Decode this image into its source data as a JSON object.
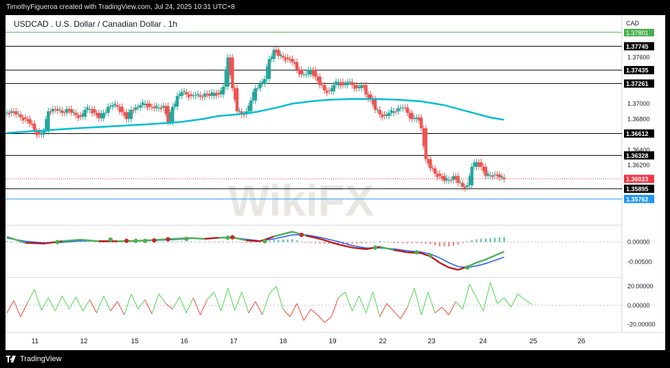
{
  "header": {
    "credit": "TimothyFigueroa created with TradingView.com, Jul 24, 2025 10:31 UTC+8"
  },
  "footer": {
    "brand": "TradingView"
  },
  "watermark": {
    "text": "WikiFX"
  },
  "chart_data": {
    "type": "candlestick",
    "title": "USDCAD . U.S. Dollar / Canadian Dollar . 1h",
    "currency": "CAD",
    "x_ticks": [
      "11",
      "12",
      "15",
      "16",
      "17",
      "18",
      "19",
      "22",
      "23",
      "24",
      "25",
      "26"
    ],
    "price_ticks": [
      1.376,
      1.37,
      1.368,
      1.364,
      1.362
    ],
    "ylim": [
      1.356,
      1.379
    ],
    "horizontal_levels": [
      {
        "label": "1.37745",
        "value": 1.37745
      },
      {
        "label": "1.37435",
        "value": 1.37435
      },
      {
        "label": "1.37261",
        "value": 1.37261
      },
      {
        "label": "1.36612",
        "value": 1.36612
      },
      {
        "label": "1.36328",
        "value": 1.36328
      },
      {
        "label": "1.35895",
        "value": 1.35895
      }
    ],
    "top_badge": {
      "label": "1.37801",
      "color": "#4caf50"
    },
    "current_price": {
      "label": "1.36023",
      "value": 1.36023,
      "color": "#f23645"
    },
    "low_line": {
      "label": "1.35762",
      "value": 1.35762,
      "color": "#2196f3"
    },
    "close_path": [
      [
        0,
        1.3688
      ],
      [
        2,
        1.369
      ],
      [
        4,
        1.3686
      ],
      [
        6,
        1.3682
      ],
      [
        8,
        1.368
      ],
      [
        10,
        1.3674
      ],
      [
        12,
        1.3664
      ],
      [
        14,
        1.366
      ],
      [
        16,
        1.3664
      ],
      [
        18,
        1.369
      ],
      [
        20,
        1.3693
      ],
      [
        22,
        1.3691
      ],
      [
        24,
        1.3688
      ],
      [
        26,
        1.3693
      ],
      [
        28,
        1.3688
      ],
      [
        30,
        1.3685
      ],
      [
        32,
        1.3683
      ],
      [
        34,
        1.3692
      ],
      [
        36,
        1.3693
      ],
      [
        38,
        1.3688
      ],
      [
        40,
        1.3681
      ],
      [
        42,
        1.3688
      ],
      [
        44,
        1.3696
      ],
      [
        46,
        1.3698
      ],
      [
        48,
        1.3696
      ],
      [
        50,
        1.3689
      ],
      [
        52,
        1.368
      ],
      [
        54,
        1.3692
      ],
      [
        56,
        1.3695
      ],
      [
        58,
        1.3698
      ],
      [
        60,
        1.37
      ],
      [
        62,
        1.3696
      ],
      [
        64,
        1.3694
      ],
      [
        66,
        1.3695
      ],
      [
        68,
        1.3697
      ],
      [
        70,
        1.3676
      ],
      [
        72,
        1.3696
      ],
      [
        74,
        1.371
      ],
      [
        76,
        1.3715
      ],
      [
        78,
        1.3712
      ],
      [
        80,
        1.371
      ],
      [
        82,
        1.3711
      ],
      [
        84,
        1.3709
      ],
      [
        86,
        1.3713
      ],
      [
        88,
        1.371
      ],
      [
        90,
        1.3714
      ],
      [
        92,
        1.3712
      ],
      [
        94,
        1.3722
      ],
      [
        96,
        1.376
      ],
      [
        98,
        1.372
      ],
      [
        100,
        1.369
      ],
      [
        102,
        1.3686
      ],
      [
        104,
        1.369
      ],
      [
        106,
        1.3704
      ],
      [
        108,
        1.372
      ],
      [
        110,
        1.3726
      ],
      [
        112,
        1.3732
      ],
      [
        114,
        1.3758
      ],
      [
        116,
        1.377
      ],
      [
        118,
        1.3762
      ],
      [
        120,
        1.376
      ],
      [
        122,
        1.3758
      ],
      [
        124,
        1.3754
      ],
      [
        126,
        1.3744
      ],
      [
        128,
        1.3738
      ],
      [
        130,
        1.3738
      ],
      [
        132,
        1.3744
      ],
      [
        134,
        1.3735
      ],
      [
        136,
        1.3724
      ],
      [
        138,
        1.3717
      ],
      [
        140,
        1.3716
      ],
      [
        142,
        1.3724
      ],
      [
        144,
        1.3728
      ],
      [
        146,
        1.3724
      ],
      [
        148,
        1.3728
      ],
      [
        150,
        1.3724
      ],
      [
        152,
        1.372
      ],
      [
        154,
        1.3724
      ],
      [
        156,
        1.3712
      ],
      [
        158,
        1.3706
      ],
      [
        160,
        1.3692
      ],
      [
        162,
        1.3686
      ],
      [
        164,
        1.3684
      ],
      [
        166,
        1.3688
      ],
      [
        168,
        1.369
      ],
      [
        170,
        1.3694
      ],
      [
        172,
        1.3695
      ],
      [
        174,
        1.3688
      ],
      [
        176,
        1.368
      ],
      [
        178,
        1.3682
      ],
      [
        180,
        1.3668
      ],
      [
        182,
        1.3628
      ],
      [
        184,
        1.3616
      ],
      [
        186,
        1.3609
      ],
      [
        188,
        1.3606
      ],
      [
        190,
        1.36
      ],
      [
        192,
        1.3601
      ],
      [
        194,
        1.3606
      ],
      [
        196,
        1.3597
      ],
      [
        198,
        1.3592
      ],
      [
        200,
        1.3594
      ],
      [
        202,
        1.3618
      ],
      [
        204,
        1.3624
      ],
      [
        206,
        1.3618
      ],
      [
        208,
        1.3606
      ],
      [
        210,
        1.3607
      ],
      [
        212,
        1.3608
      ],
      [
        214,
        1.3604
      ],
      [
        216,
        1.3602
      ]
    ],
    "ema_path": [
      [
        0,
        1.3662
      ],
      [
        30,
        1.3668
      ],
      [
        60,
        1.3673
      ],
      [
        75,
        1.3676
      ],
      [
        85,
        1.368
      ],
      [
        92,
        1.3684
      ],
      [
        100,
        1.3686
      ],
      [
        108,
        1.3689
      ],
      [
        116,
        1.3694
      ],
      [
        124,
        1.37
      ],
      [
        132,
        1.3703
      ],
      [
        140,
        1.3705
      ],
      [
        150,
        1.3706
      ],
      [
        160,
        1.3706
      ],
      [
        170,
        1.3705
      ],
      [
        180,
        1.3703
      ],
      [
        190,
        1.3698
      ],
      [
        200,
        1.369
      ],
      [
        210,
        1.3682
      ],
      [
        216,
        1.3679
      ]
    ],
    "macd": {
      "ticks": [
        "0.00000",
        "-0.00500"
      ],
      "range": [
        -0.0082,
        0.0032
      ],
      "fast": [
        [
          0,
          0.0013
        ],
        [
          8,
          -0.0002
        ],
        [
          16,
          -0.0004
        ],
        [
          24,
          0.0002
        ],
        [
          32,
          0.0006
        ],
        [
          40,
          0.0002
        ],
        [
          48,
          0.0002
        ],
        [
          56,
          0.0003
        ],
        [
          64,
          0.0005
        ],
        [
          72,
          0.0008
        ],
        [
          80,
          0.001
        ],
        [
          86,
          0.0008
        ],
        [
          92,
          0.0011
        ],
        [
          98,
          0.0012
        ],
        [
          104,
          0.0004
        ],
        [
          110,
          0.0002
        ],
        [
          116,
          0.0014
        ],
        [
          124,
          0.0026
        ],
        [
          130,
          0.0016
        ],
        [
          136,
          0.0008
        ],
        [
          144,
          -0.0006
        ],
        [
          150,
          -0.0014
        ],
        [
          156,
          -0.0018
        ],
        [
          162,
          -0.0012
        ],
        [
          168,
          -0.002
        ],
        [
          174,
          -0.0026
        ],
        [
          180,
          -0.0028
        ],
        [
          184,
          -0.0036
        ],
        [
          188,
          -0.0052
        ],
        [
          192,
          -0.0064
        ],
        [
          196,
          -0.007
        ],
        [
          200,
          -0.0062
        ],
        [
          204,
          -0.0052
        ],
        [
          208,
          -0.0044
        ],
        [
          212,
          -0.0034
        ],
        [
          216,
          -0.0024
        ]
      ],
      "slow": [
        [
          0,
          0.001
        ],
        [
          8,
          0.0002
        ],
        [
          16,
          -0.0002
        ],
        [
          24,
          -0.0001
        ],
        [
          32,
          0.0003
        ],
        [
          40,
          0.0003
        ],
        [
          48,
          0.0002
        ],
        [
          56,
          0.0003
        ],
        [
          64,
          0.0004
        ],
        [
          72,
          0.0006
        ],
        [
          80,
          0.0009
        ],
        [
          86,
          0.0009
        ],
        [
          92,
          0.001
        ],
        [
          98,
          0.0011
        ],
        [
          104,
          0.0007
        ],
        [
          110,
          0.0003
        ],
        [
          116,
          0.0008
        ],
        [
          124,
          0.0018
        ],
        [
          130,
          0.0018
        ],
        [
          136,
          0.0012
        ],
        [
          144,
          0.0001
        ],
        [
          150,
          -0.0009
        ],
        [
          156,
          -0.0015
        ],
        [
          162,
          -0.0015
        ],
        [
          168,
          -0.0017
        ],
        [
          174,
          -0.0022
        ],
        [
          180,
          -0.0025
        ],
        [
          184,
          -0.003
        ],
        [
          188,
          -0.004
        ],
        [
          192,
          -0.0052
        ],
        [
          196,
          -0.0062
        ],
        [
          200,
          -0.0064
        ],
        [
          204,
          -0.006
        ],
        [
          208,
          -0.0054
        ],
        [
          212,
          -0.0046
        ],
        [
          216,
          -0.0038
        ]
      ],
      "cross_points": [
        [
          22,
          0.0
        ],
        [
          45,
          0.0006
        ],
        [
          52,
          0.0003
        ],
        [
          56,
          0.0003
        ],
        [
          60,
          0.0003
        ],
        [
          64,
          0.0004
        ],
        [
          70,
          0.0007
        ],
        [
          78,
          0.0008
        ],
        [
          96,
          0.0011
        ],
        [
          98,
          0.0012
        ],
        [
          112,
          0.0002
        ],
        [
          128,
          0.0018
        ],
        [
          160,
          -0.0014
        ],
        [
          178,
          -0.0026
        ],
        [
          184,
          -0.0034
        ],
        [
          200,
          -0.0064
        ]
      ]
    },
    "oscillator": {
      "ticks": [
        "20.00000",
        "0.00000",
        "-20.00000"
      ],
      "range": [
        -24,
        28
      ],
      "values": [
        [
          0,
          -8
        ],
        [
          3,
          5
        ],
        [
          6,
          -12
        ],
        [
          9,
          3
        ],
        [
          12,
          17
        ],
        [
          15,
          -5
        ],
        [
          18,
          8
        ],
        [
          21,
          -6
        ],
        [
          24,
          10
        ],
        [
          27,
          -4
        ],
        [
          30,
          9
        ],
        [
          33,
          -6
        ],
        [
          36,
          6
        ],
        [
          39,
          -8
        ],
        [
          42,
          10
        ],
        [
          45,
          -6
        ],
        [
          48,
          4
        ],
        [
          51,
          -10
        ],
        [
          54,
          12
        ],
        [
          57,
          -4
        ],
        [
          60,
          6
        ],
        [
          63,
          -9
        ],
        [
          66,
          12
        ],
        [
          69,
          2
        ],
        [
          72,
          -4
        ],
        [
          75,
          9
        ],
        [
          78,
          -8
        ],
        [
          81,
          8
        ],
        [
          84,
          -10
        ],
        [
          87,
          6
        ],
        [
          90,
          14
        ],
        [
          93,
          -6
        ],
        [
          96,
          18
        ],
        [
          99,
          -5
        ],
        [
          102,
          14
        ],
        [
          105,
          -8
        ],
        [
          108,
          4
        ],
        [
          111,
          -10
        ],
        [
          114,
          12
        ],
        [
          117,
          20
        ],
        [
          120,
          -4
        ],
        [
          123,
          -12
        ],
        [
          126,
          2
        ],
        [
          129,
          -16
        ],
        [
          132,
          -4
        ],
        [
          135,
          -10
        ],
        [
          138,
          -18
        ],
        [
          141,
          -12
        ],
        [
          144,
          8
        ],
        [
          147,
          14
        ],
        [
          150,
          -6
        ],
        [
          153,
          10
        ],
        [
          156,
          -8
        ],
        [
          159,
          14
        ],
        [
          162,
          -12
        ],
        [
          165,
          2
        ],
        [
          168,
          -6
        ],
        [
          171,
          -14
        ],
        [
          174,
          -2
        ],
        [
          177,
          18
        ],
        [
          180,
          -10
        ],
        [
          183,
          14
        ],
        [
          186,
          -8
        ],
        [
          189,
          -2
        ],
        [
          192,
          -10
        ],
        [
          195,
          4
        ],
        [
          198,
          -4
        ],
        [
          201,
          22
        ],
        [
          204,
          8
        ],
        [
          207,
          -6
        ],
        [
          210,
          24
        ],
        [
          213,
          2
        ],
        [
          216,
          8
        ],
        [
          219,
          -2
        ],
        [
          222,
          12
        ],
        [
          225,
          6
        ],
        [
          228,
          1
        ]
      ]
    }
  }
}
